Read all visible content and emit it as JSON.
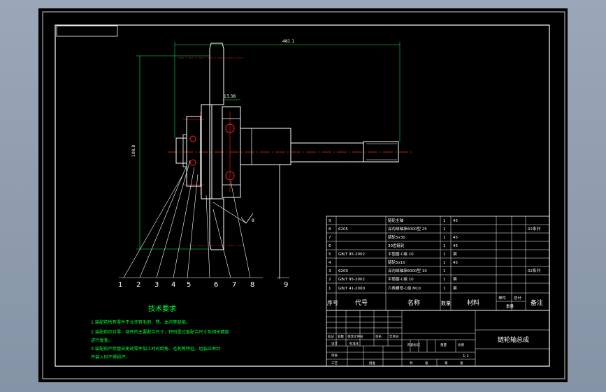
{
  "drawing": {
    "title": "链轮轴总成",
    "scale": "1:1"
  },
  "dimensions": {
    "overall_length": "481.1",
    "height": "108.8",
    "sprocket_width": "13.38",
    "roughness": "8"
  },
  "balloons": [
    "1",
    "2",
    "3",
    "4",
    "5",
    "6",
    "7",
    "8",
    "9"
  ],
  "tech_requirements": {
    "heading": "技术要求",
    "lines": [
      "1.装配前所有零件不允许有毛刺、锈、油污等缺陷。",
      "2.装配前应对零、部件的主要配合尺寸，特别是过盈配合尺寸及相关精度",
      "进行复查。",
      "3.装配前严禁擅自更改零件加工时的倒角、毛刺等特征。组装应密封",
      "件装入时不得损坏。"
    ]
  },
  "parts_header": {
    "no": "序号",
    "code": "代号",
    "name": "名称",
    "qty": "数量",
    "material": "材料",
    "unit": "单件",
    "total": "总计",
    "weight": "重量",
    "remark": "备注"
  },
  "parts": [
    {
      "no": "9",
      "code": "",
      "name": "链轮主轴",
      "qty": "1",
      "material": "45",
      "remark": ""
    },
    {
      "no": "8",
      "code": "6205",
      "name": "深沟球轴承6000型 25",
      "qty": "1",
      "material": "",
      "remark": "02系列"
    },
    {
      "no": "7",
      "code": "",
      "name": "链轮5x30",
      "qty": "1",
      "material": "45",
      "remark": ""
    },
    {
      "no": "6",
      "code": "",
      "name": "30齿链轮",
      "qty": "1",
      "material": "45",
      "remark": ""
    },
    {
      "no": "5",
      "code": "GB/T 95-2002",
      "name": "平垫圈-C级 10",
      "qty": "1",
      "material": "钢",
      "remark": ""
    },
    {
      "no": "4",
      "code": "",
      "name": "链轮5x10",
      "qty": "1",
      "material": "45",
      "remark": ""
    },
    {
      "no": "3",
      "code": "6200",
      "name": "深沟球轴承6000型 10",
      "qty": "1",
      "material": "",
      "remark": "02系列"
    },
    {
      "no": "2",
      "code": "GB/T 95-2002",
      "name": "平垫圈-C级 10",
      "qty": "1",
      "material": "钢",
      "remark": ""
    },
    {
      "no": "1",
      "code": "GB/T 41-2000",
      "name": "六角螺母-C级 M10",
      "qty": "1",
      "material": "钢",
      "remark": ""
    }
  ],
  "title_block": {
    "row_labels": [
      "标记",
      "处数",
      "更改文件号",
      "签名",
      "年月日"
    ],
    "designer": "设计",
    "standard": "标准化",
    "stage": "阶段标记",
    "weight": "重量",
    "scale_label": "比例",
    "review": "审核",
    "process": "工艺",
    "approve": "批准",
    "sheets": "共",
    "sheet": "张",
    "sheet_of": "第",
    "sheet_unit": "张"
  }
}
